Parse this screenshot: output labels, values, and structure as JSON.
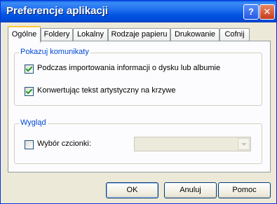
{
  "window": {
    "title": "Preferencje aplikacji",
    "help_label": "?",
    "close_label": "✕"
  },
  "tabs": [
    {
      "label": "Ogólne",
      "active": true
    },
    {
      "label": "Foldery"
    },
    {
      "label": "Lokalny"
    },
    {
      "label": "Rodzaje papieru"
    },
    {
      "label": "Drukowanie"
    },
    {
      "label": "Cofnij"
    }
  ],
  "messages_group": {
    "title": "Pokazuj komunikaty",
    "options": [
      {
        "label": "Podczas importowania informacji o dysku lub albumie",
        "checked": true
      },
      {
        "label": "Konwertując tekst artystyczny na krzywe",
        "checked": true
      }
    ]
  },
  "appearance_group": {
    "title": "Wygląd",
    "font_choice": {
      "label": "Wybór czcionki:",
      "checked": false,
      "value": ""
    }
  },
  "buttons": {
    "ok": "OK",
    "cancel": "Anuluj",
    "help": "Pomoc"
  },
  "colors": {
    "titlebar": "#0a5fe6",
    "group_title": "#0046d5",
    "checkmark": "#21a121",
    "active_tab_highlight": "#ffc83c"
  }
}
